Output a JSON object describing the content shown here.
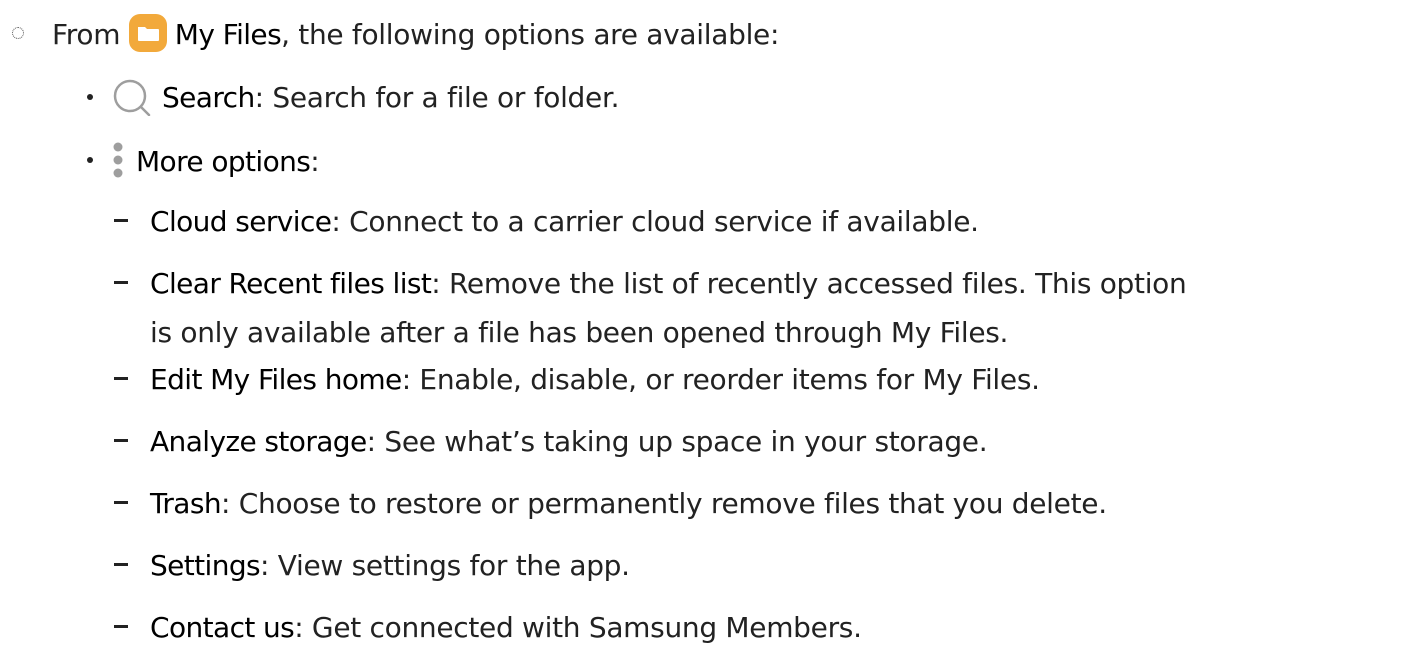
{
  "intro": {
    "prefix": "From",
    "app_name": "My Files",
    "suffix": ", the following options are available:"
  },
  "items": [
    {
      "icon": "search-icon",
      "term": "Search",
      "sep": ":",
      "desc": " Search for a file or folder."
    },
    {
      "icon": "more-options-icon",
      "term": "More options",
      "sep": ":",
      "desc": ""
    }
  ],
  "more_options": [
    {
      "term": "Cloud service",
      "sep": ":",
      "desc": " Connect to a carrier cloud service if available."
    },
    {
      "term": "Clear Recent files list",
      "sep": ":",
      "desc": " Remove the list of recently accessed files. This option",
      "desc_cont": "is only available after a file has been opened through My Files."
    },
    {
      "term": "Edit My Files home",
      "sep": ":",
      "desc": " Enable, disable, or reorder items for My Files."
    },
    {
      "term": "Analyze storage",
      "sep": ":",
      "desc": " See what’s taking up space in your storage."
    },
    {
      "term": "Trash",
      "sep": ":",
      "desc": " Choose to restore or permanently remove files that you delete."
    },
    {
      "term": "Settings",
      "sep": ":",
      "desc": " View settings for the app."
    },
    {
      "term": "Contact us",
      "sep": ":",
      "desc": " Get connected with Samsung Members."
    }
  ],
  "colors": {
    "text": "#222222",
    "term": "#000000",
    "folder_icon": "#F2A93B",
    "search_icon": "#9E9E9E",
    "more_icon": "#9E9E9E"
  }
}
